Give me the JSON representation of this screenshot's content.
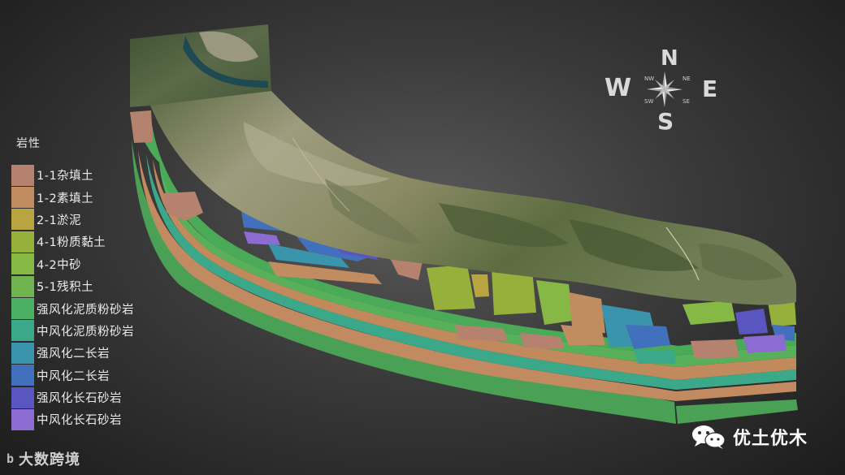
{
  "legend": {
    "title": "岩性",
    "items": [
      {
        "label": "1-1杂填土",
        "color": "#b4826e"
      },
      {
        "label": "1-2素填土",
        "color": "#c08c60"
      },
      {
        "label": "2-1淤泥",
        "color": "#b8a440"
      },
      {
        "label": "4-1粉质黏土",
        "color": "#96b03c"
      },
      {
        "label": "4-2中砂",
        "color": "#86b846"
      },
      {
        "label": "5-1残积土",
        "color": "#70b450"
      },
      {
        "label": "强风化泥质粉砂岩",
        "color": "#4cb064"
      },
      {
        "label": "中风化泥质粉砂岩",
        "color": "#3ca88a"
      },
      {
        "label": "强风化二长岩",
        "color": "#3a94ac"
      },
      {
        "label": "中风化二长岩",
        "color": "#4270bc"
      },
      {
        "label": "强风化长石砂岩",
        "color": "#5a56c0"
      },
      {
        "label": "中风化长石砂岩",
        "color": "#8c6cd0"
      }
    ]
  },
  "compass": {
    "n": "N",
    "s": "S",
    "e": "E",
    "w": "W",
    "nw": "NW",
    "ne": "NE",
    "sw": "SW",
    "se": "SE"
  },
  "watermark": {
    "text": "优土优木",
    "icon": "wechat-icon"
  },
  "brand": {
    "logo": "b",
    "text": "大数跨境"
  },
  "colors": {
    "terrain": "#7a7b5c",
    "forest": "#4e5e38",
    "water": "#1f4a52",
    "bare": "#a9a58a"
  }
}
